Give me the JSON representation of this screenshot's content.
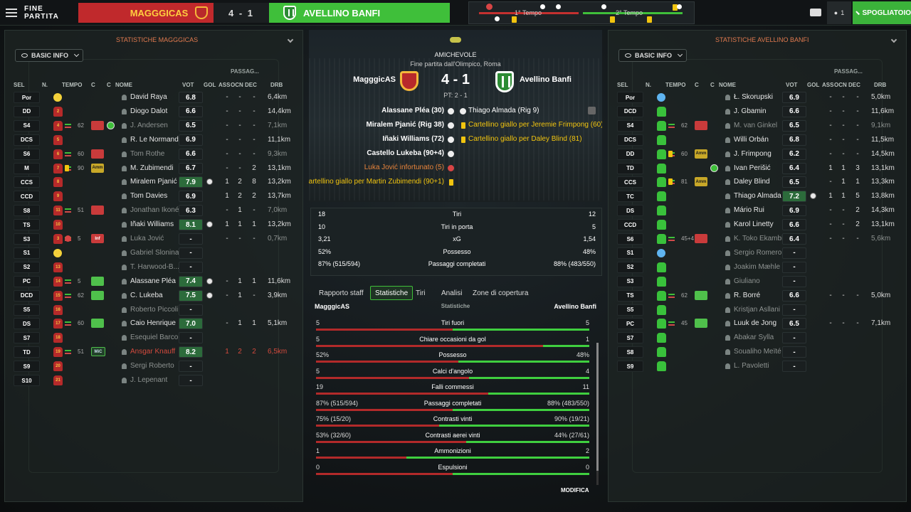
{
  "topbar": {
    "end_label": "FINE PARTITA",
    "home": "MAGGGICAS",
    "score": "4 - 1",
    "away": "AVELLINO BANFI",
    "first_half": "1° Tempo",
    "second_half": "2° Tempo",
    "users_count": "1",
    "spogliatoio": "SPOGLIATOIO"
  },
  "home_panel": {
    "title": "STATISTICHE MAGGGICAS",
    "basic_info": "BASIC INFO",
    "group": "PASSAG...",
    "cols": {
      "sel": "SEL",
      "n": "N.",
      "tempo": "TEMPO",
      "c1": "C",
      "c2": "C",
      "nome": "NOME",
      "vot": "VOT",
      "gol": "GOL",
      "ass": "ASS",
      "ocn": "OCN",
      "dec": "DEC",
      "drb": "DRB"
    },
    "players": [
      {
        "pos": "Por",
        "n": "1",
        "mins": "",
        "badge": "",
        "name": "David Raya",
        "vot": "6.8",
        "gol": "",
        "ass": "-",
        "ocn": "-",
        "dec": "-",
        "drb": "6,4km",
        "dim": false
      },
      {
        "pos": "DD",
        "n": "2",
        "mins": "",
        "badge": "",
        "name": "Diogo Dalot",
        "vot": "6.6",
        "gol": "",
        "ass": "-",
        "ocn": "-",
        "dec": "-",
        "drb": "14,4km",
        "dim": false
      },
      {
        "pos": "S4",
        "n": "4",
        "mins": "62",
        "badge": "",
        "name": "J. Andersen",
        "vot": "6.5",
        "gol": "",
        "ass": "-",
        "ocn": "-",
        "dec": "-",
        "drb": "7,1km",
        "dim": true
      },
      {
        "pos": "DCS",
        "n": "5",
        "mins": "",
        "badge": "",
        "name": "R. Le Normand",
        "vot": "6.9",
        "gol": "",
        "ass": "-",
        "ocn": "-",
        "dec": "-",
        "drb": "11,1km",
        "dim": false
      },
      {
        "pos": "S6",
        "n": "6",
        "mins": "60",
        "badge": "",
        "name": "Tom Rothe",
        "vot": "6.6",
        "gol": "",
        "ass": "-",
        "ocn": "-",
        "dec": "-",
        "drb": "9,3km",
        "dim": true
      },
      {
        "pos": "M",
        "n": "7",
        "mins": "90",
        "badge": "Amm",
        "name": "M. Zubimendi",
        "vot": "6.7",
        "gol": "",
        "ass": "-",
        "ocn": "-",
        "dec": "2",
        "drb": "13,1km",
        "dim": false
      },
      {
        "pos": "CCS",
        "n": "8",
        "mins": "",
        "badge": "",
        "name": "Miralem Pjanić",
        "vot": "7.9",
        "gol": "ball",
        "ass": "1",
        "ocn": "2",
        "dec": "8",
        "drb": "13,2km",
        "dim": false
      },
      {
        "pos": "CCD",
        "n": "9",
        "mins": "",
        "badge": "",
        "name": "Tom Davies",
        "vot": "6.9",
        "gol": "",
        "ass": "1",
        "ocn": "2",
        "dec": "2",
        "drb": "13,7km",
        "dim": false
      },
      {
        "pos": "S8",
        "n": "11",
        "mins": "51",
        "badge": "",
        "name": "Jonathan Ikoné",
        "vot": "6.3",
        "gol": "",
        "ass": "-",
        "ocn": "1",
        "dec": "-",
        "drb": "7,0km",
        "dim": true
      },
      {
        "pos": "TS",
        "n": "10",
        "mins": "",
        "badge": "",
        "name": "Iñaki Williams",
        "vot": "8.1",
        "gol": "ball",
        "ass": "1",
        "ocn": "1",
        "dec": "1",
        "drb": "13,2km",
        "dim": false
      },
      {
        "pos": "S3",
        "n": "3",
        "mins": "5",
        "badge": "Inf",
        "name": "Luka Jović",
        "vot": "-",
        "gol": "",
        "ass": "-",
        "ocn": "-",
        "dec": "-",
        "drb": "0,7km",
        "dim": true
      },
      {
        "pos": "S1",
        "n": "12",
        "mins": "",
        "badge": "",
        "name": "Gabriel Slonina",
        "vot": "-",
        "gol": "",
        "ass": "",
        "ocn": "",
        "dec": "",
        "drb": "",
        "dim": true
      },
      {
        "pos": "S2",
        "n": "13",
        "mins": "",
        "badge": "",
        "name": "T. Harwood-B...",
        "vot": "-",
        "gol": "",
        "ass": "",
        "ocn": "",
        "dec": "",
        "drb": "",
        "dim": true
      },
      {
        "pos": "PC",
        "n": "14",
        "mins": "5",
        "badge": "",
        "name": "Alassane Pléa",
        "vot": "7.4",
        "gol": "ball",
        "ass": "-",
        "ocn": "1",
        "dec": "1",
        "drb": "11,6km",
        "dim": false
      },
      {
        "pos": "DCD",
        "n": "15",
        "mins": "62",
        "badge": "",
        "name": "C. Lukeba",
        "vot": "7.5",
        "gol": "ball",
        "ass": "-",
        "ocn": "1",
        "dec": "-",
        "drb": "3,9km",
        "dim": false
      },
      {
        "pos": "S5",
        "n": "16",
        "mins": "",
        "badge": "",
        "name": "Roberto Piccoli",
        "vot": "-",
        "gol": "",
        "ass": "",
        "ocn": "",
        "dec": "",
        "drb": "",
        "dim": true
      },
      {
        "pos": "DS",
        "n": "17",
        "mins": "60",
        "badge": "",
        "name": "Caio Henrique",
        "vot": "7.0",
        "gol": "",
        "ass": "-",
        "ocn": "1",
        "dec": "1",
        "drb": "5,1km",
        "dim": false
      },
      {
        "pos": "S7",
        "n": "18",
        "mins": "",
        "badge": "",
        "name": "Esequiel Barco",
        "vot": "-",
        "gol": "",
        "ass": "",
        "ocn": "",
        "dec": "",
        "drb": "",
        "dim": true
      },
      {
        "pos": "TD",
        "n": "19",
        "mins": "51",
        "badge": "MiC",
        "name": "Ansgar Knauff",
        "vot": "8.2",
        "gol": "",
        "ass": "1",
        "ocn": "2",
        "dec": "2",
        "drb": "6,5km",
        "dim": false,
        "red": true
      },
      {
        "pos": "S9",
        "n": "20",
        "mins": "",
        "badge": "",
        "name": "Sergi Roberto",
        "vot": "-",
        "gol": "",
        "ass": "",
        "ocn": "",
        "dec": "",
        "drb": "",
        "dim": true
      },
      {
        "pos": "S10",
        "n": "21",
        "mins": "",
        "badge": "",
        "name": "J. Lepenant",
        "vot": "-",
        "gol": "",
        "ass": "",
        "ocn": "",
        "dec": "",
        "drb": "",
        "dim": true
      }
    ]
  },
  "away_panel": {
    "title": "STATISTICHE AVELLINO BANFI",
    "basic_info": "BASIC INFO",
    "group": "PASSAG...",
    "cols": {
      "sel": "SEL",
      "n": "N.",
      "tempo": "TEMPO",
      "c1": "C",
      "c2": "C",
      "nome": "NOME",
      "vot": "VOT",
      "gol": "GOL",
      "ass": "ASS",
      "ocn": "OCN",
      "dec": "DEC",
      "drb": "DRB"
    },
    "players": [
      {
        "pos": "Por",
        "mins": "",
        "badge": "",
        "name": "Ł. Skorupski",
        "vot": "6.9",
        "gol": "",
        "ass": "-",
        "ocn": "-",
        "dec": "-",
        "drb": "5,0km",
        "dim": false
      },
      {
        "pos": "DCD",
        "mins": "",
        "badge": "",
        "name": "J. Gbamin",
        "vot": "6.6",
        "gol": "",
        "ass": "-",
        "ocn": "-",
        "dec": "-",
        "drb": "11,6km",
        "dim": false
      },
      {
        "pos": "S4",
        "mins": "62",
        "badge": "",
        "name": "M. van Ginkel",
        "vot": "6.5",
        "gol": "",
        "ass": "-",
        "ocn": "-",
        "dec": "-",
        "drb": "9,1km",
        "dim": true
      },
      {
        "pos": "DCS",
        "mins": "",
        "badge": "",
        "name": "Willi Orbán",
        "vot": "6.8",
        "gol": "",
        "ass": "-",
        "ocn": "-",
        "dec": "-",
        "drb": "11,5km",
        "dim": false
      },
      {
        "pos": "DD",
        "mins": "60",
        "badge": "Amm",
        "name": "J. Frimpong",
        "vot": "6.2",
        "gol": "",
        "ass": "-",
        "ocn": "-",
        "dec": "-",
        "drb": "14,5km",
        "dim": false
      },
      {
        "pos": "TD",
        "mins": "",
        "badge": "",
        "name": "Ivan Perišić",
        "vot": "6.4",
        "gol": "",
        "ass": "1",
        "ocn": "1",
        "dec": "3",
        "drb": "13,1km",
        "dim": false
      },
      {
        "pos": "CCS",
        "mins": "81",
        "badge": "Amm",
        "name": "Daley Blind",
        "vot": "6.5",
        "gol": "",
        "ass": "-",
        "ocn": "1",
        "dec": "1",
        "drb": "13,3km",
        "dim": false
      },
      {
        "pos": "TC",
        "mins": "",
        "badge": "",
        "name": "Thiago Almada",
        "vot": "7.2",
        "gol": "ball",
        "ass": "1",
        "ocn": "1",
        "dec": "5",
        "drb": "13,8km",
        "dim": false
      },
      {
        "pos": "DS",
        "mins": "",
        "badge": "",
        "name": "Mário Rui",
        "vot": "6.9",
        "gol": "",
        "ass": "-",
        "ocn": "-",
        "dec": "2",
        "drb": "14,3km",
        "dim": false
      },
      {
        "pos": "CCD",
        "mins": "",
        "badge": "",
        "name": "Karol Linetty",
        "vot": "6.6",
        "gol": "",
        "ass": "-",
        "ocn": "-",
        "dec": "2",
        "drb": "13,1km",
        "dim": false
      },
      {
        "pos": "S6",
        "mins": "45+4",
        "badge": "",
        "name": "K. Toko Ekambi",
        "vot": "6.4",
        "gol": "",
        "ass": "-",
        "ocn": "-",
        "dec": "-",
        "drb": "5,6km",
        "dim": true
      },
      {
        "pos": "S1",
        "mins": "",
        "badge": "",
        "name": "Sergio Romero",
        "vot": "-",
        "gol": "",
        "ass": "",
        "ocn": "",
        "dec": "",
        "drb": "",
        "dim": true
      },
      {
        "pos": "S2",
        "mins": "",
        "badge": "",
        "name": "Joakim Mæhle",
        "vot": "-",
        "gol": "",
        "ass": "",
        "ocn": "",
        "dec": "",
        "drb": "",
        "dim": true
      },
      {
        "pos": "S3",
        "mins": "",
        "badge": "",
        "name": "Giuliano",
        "vot": "-",
        "gol": "",
        "ass": "",
        "ocn": "",
        "dec": "",
        "drb": "",
        "dim": true
      },
      {
        "pos": "TS",
        "mins": "62",
        "badge": "",
        "name": "R. Borré",
        "vot": "6.6",
        "gol": "",
        "ass": "-",
        "ocn": "-",
        "dec": "-",
        "drb": "5,0km",
        "dim": false
      },
      {
        "pos": "S5",
        "mins": "",
        "badge": "",
        "name": "Kristjan Asllani",
        "vot": "-",
        "gol": "",
        "ass": "",
        "ocn": "",
        "dec": "",
        "drb": "",
        "dim": true
      },
      {
        "pos": "PC",
        "mins": "45",
        "badge": "",
        "name": "Luuk de Jong",
        "vot": "6.5",
        "gol": "",
        "ass": "-",
        "ocn": "-",
        "dec": "-",
        "drb": "7,1km",
        "dim": false
      },
      {
        "pos": "S7",
        "mins": "",
        "badge": "",
        "name": "Abakar Sylla",
        "vot": "-",
        "gol": "",
        "ass": "",
        "ocn": "",
        "dec": "",
        "drb": "",
        "dim": true
      },
      {
        "pos": "S8",
        "mins": "",
        "badge": "",
        "name": "Soualiho Meïté",
        "vot": "-",
        "gol": "",
        "ass": "",
        "ocn": "",
        "dec": "",
        "drb": "",
        "dim": true
      },
      {
        "pos": "S9",
        "mins": "",
        "badge": "",
        "name": "L. Pavoletti",
        "vot": "-",
        "gol": "",
        "ass": "",
        "ocn": "",
        "dec": "",
        "drb": "",
        "dim": true
      }
    ]
  },
  "match": {
    "competition": "AMICHEVOLE",
    "venue": "Fine partita dall'Olimpico, Roma",
    "home": "MagggicAS",
    "away": "Avellino Banfi",
    "score": "4 - 1",
    "ht": "PT: 2 - 1",
    "events_home": [
      "Alassane Pléa (30)",
      "Miralem Pjanić (Rig 38)",
      "Iñaki Williams (72)",
      "Castello Lukeba (90+4)",
      "Luka Jović infortunato (5)",
      "Cartellino giallo per Martin Zubimendi (90+1)"
    ],
    "events_away": [
      "Thiago Almada (Rig 9)",
      "Cartellino giallo per Jeremie Frimpong (60)",
      "Cartellino giallo per Daley Blind (81)"
    ]
  },
  "summary": [
    {
      "l": "18",
      "c": "Tiri",
      "r": "12"
    },
    {
      "l": "10",
      "c": "Tiri in porta",
      "r": "5"
    },
    {
      "l": "3,21",
      "c": "xG",
      "r": "1,54"
    },
    {
      "l": "52%",
      "c": "Possesso",
      "r": "48%"
    },
    {
      "l": "87% (515/594)",
      "c": "Passaggi completati",
      "r": "88% (483/550)"
    }
  ],
  "tabs": [
    "Rapporto staff",
    "Statistiche",
    "Tiri",
    "Analisi",
    "Zone di copertura"
  ],
  "stats_header": {
    "home": "MagggicAS",
    "mid": "Statistiche",
    "away": "Avellino Banfi"
  },
  "stats": [
    {
      "l": "5",
      "c": "Tiri fuori",
      "r": "5",
      "away_share": 0.5
    },
    {
      "l": "5",
      "c": "Chiare occasioni da gol",
      "r": "1",
      "away_share": 0.17
    },
    {
      "l": "52%",
      "c": "Possesso",
      "r": "48%",
      "away_share": 0.48
    },
    {
      "l": "5",
      "c": "Calci d'angolo",
      "r": "4",
      "away_share": 0.44
    },
    {
      "l": "19",
      "c": "Falli commessi",
      "r": "11",
      "away_share": 0.37
    },
    {
      "l": "87% (515/594)",
      "c": "Passaggi completati",
      "r": "88% (483/550)",
      "away_share": 0.5
    },
    {
      "l": "75% (15/20)",
      "c": "Contrasti vinti",
      "r": "90% (19/21)",
      "away_share": 0.55
    },
    {
      "l": "53% (32/60)",
      "c": "Contrasti aerei vinti",
      "r": "44% (27/61)",
      "away_share": 0.45
    },
    {
      "l": "1",
      "c": "Ammonizioni",
      "r": "2",
      "away_share": 0.67
    },
    {
      "l": "0",
      "c": "Espulsioni",
      "r": "0",
      "away_share": 0.5
    }
  ],
  "modifica": "MODIFICA",
  "colors": {
    "home": "#c0292c",
    "away": "#3fbf3a",
    "accent_title": "#e07a4f"
  },
  "icons": [
    "menu-icon",
    "home-crest-icon",
    "away-crest-icon",
    "truck-icon",
    "users-icon",
    "eye-icon",
    "chevron-down-icon",
    "ball-icon",
    "yellow-card-icon",
    "injury-icon",
    "substitution-icon",
    "shirt-icon",
    "person-icon",
    "captain-icon"
  ]
}
